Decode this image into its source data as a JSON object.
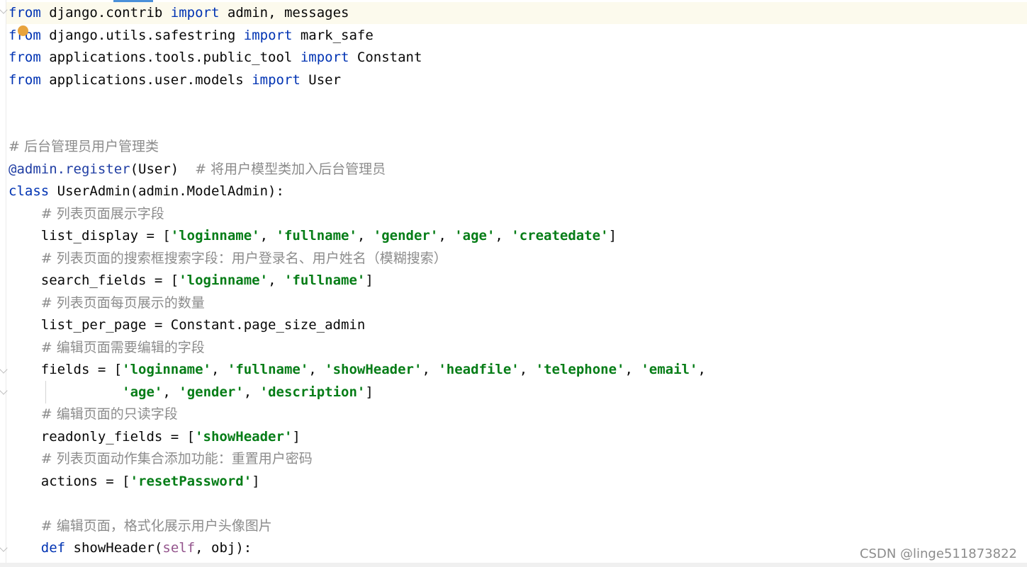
{
  "lines": [
    [
      {
        "t": "from",
        "c": "kw"
      },
      {
        "t": " django.contrib "
      },
      {
        "t": "import",
        "c": "kw"
      },
      {
        "t": " admin, messages"
      }
    ],
    [
      {
        "t": "from",
        "c": "kw"
      },
      {
        "t": " django.utils.safestring "
      },
      {
        "t": "import",
        "c": "kw"
      },
      {
        "t": " mark_safe"
      }
    ],
    [
      {
        "t": "from",
        "c": "kw"
      },
      {
        "t": " applications.tools.public_tool "
      },
      {
        "t": "import",
        "c": "kw"
      },
      {
        "t": " Constant"
      }
    ],
    [
      {
        "t": "from",
        "c": "kw"
      },
      {
        "t": " applications.user.models "
      },
      {
        "t": "import",
        "c": "kw"
      },
      {
        "t": " User"
      }
    ],
    [],
    [],
    [
      {
        "t": "# 后台管理员用户管理类",
        "c": "cmt"
      }
    ],
    [
      {
        "t": "@admin.register",
        "c": "deco"
      },
      {
        "t": "(User)  "
      },
      {
        "t": "# 将用户模型类加入后台管理员",
        "c": "cmt"
      }
    ],
    [
      {
        "t": "class",
        "c": "kw"
      },
      {
        "t": " UserAdmin(admin.ModelAdmin):"
      }
    ],
    [
      {
        "t": "    "
      },
      {
        "t": "# 列表页面展示字段",
        "c": "cmt"
      }
    ],
    [
      {
        "t": "    list_display = ["
      },
      {
        "t": "'loginname'",
        "c": "str"
      },
      {
        "t": ", "
      },
      {
        "t": "'fullname'",
        "c": "str"
      },
      {
        "t": ", "
      },
      {
        "t": "'gender'",
        "c": "str"
      },
      {
        "t": ", "
      },
      {
        "t": "'age'",
        "c": "str"
      },
      {
        "t": ", "
      },
      {
        "t": "'createdate'",
        "c": "str"
      },
      {
        "t": "]"
      }
    ],
    [
      {
        "t": "    "
      },
      {
        "t": "# 列表页面的搜索框搜索字段：用户登录名、用户姓名（模糊搜索）",
        "c": "cmt"
      }
    ],
    [
      {
        "t": "    search_fields = ["
      },
      {
        "t": "'loginname'",
        "c": "str"
      },
      {
        "t": ", "
      },
      {
        "t": "'fullname'",
        "c": "str"
      },
      {
        "t": "]"
      }
    ],
    [
      {
        "t": "    "
      },
      {
        "t": "# 列表页面每页展示的数量",
        "c": "cmt"
      }
    ],
    [
      {
        "t": "    list_per_page = Constant.page_size_admin"
      }
    ],
    [
      {
        "t": "    "
      },
      {
        "t": "# 编辑页面需要编辑的字段",
        "c": "cmt"
      }
    ],
    [
      {
        "t": "    fields = ["
      },
      {
        "t": "'loginname'",
        "c": "str"
      },
      {
        "t": ", "
      },
      {
        "t": "'fullname'",
        "c": "str"
      },
      {
        "t": ", "
      },
      {
        "t": "'showHeader'",
        "c": "str"
      },
      {
        "t": ", "
      },
      {
        "t": "'headfile'",
        "c": "str"
      },
      {
        "t": ", "
      },
      {
        "t": "'telephone'",
        "c": "str"
      },
      {
        "t": ", "
      },
      {
        "t": "'email'",
        "c": "str"
      },
      {
        "t": ","
      }
    ],
    [
      {
        "t": "              "
      },
      {
        "t": "'age'",
        "c": "str"
      },
      {
        "t": ", "
      },
      {
        "t": "'gender'",
        "c": "str"
      },
      {
        "t": ", "
      },
      {
        "t": "'description'",
        "c": "str"
      },
      {
        "t": "]"
      }
    ],
    [
      {
        "t": "    "
      },
      {
        "t": "# 编辑页面的只读字段",
        "c": "cmt"
      }
    ],
    [
      {
        "t": "    readonly_fields = ["
      },
      {
        "t": "'showHeader'",
        "c": "str"
      },
      {
        "t": "]"
      }
    ],
    [
      {
        "t": "    "
      },
      {
        "t": "# 列表页面动作集合添加功能：重置用户密码",
        "c": "cmt"
      }
    ],
    [
      {
        "t": "    actions = ["
      },
      {
        "t": "'resetPassword'",
        "c": "str"
      },
      {
        "t": "]"
      }
    ],
    [],
    [
      {
        "t": "    "
      },
      {
        "t": "# 编辑页面，格式化展示用户头像图片",
        "c": "cmt"
      }
    ],
    [
      {
        "t": "    "
      },
      {
        "t": "def",
        "c": "kw"
      },
      {
        "t": " showHeader("
      },
      {
        "t": "self",
        "c": "self"
      },
      {
        "t": ", obj):"
      }
    ]
  ],
  "watermark": "CSDN @linge511873822",
  "icons": {
    "gutter_marker": "bulb-icon",
    "fold": "fold-arrow-icon"
  },
  "colors": {
    "keyword": "#0033b3",
    "string": "#067d17",
    "comment": "#8c8c8c",
    "decorator": "#1f3da3",
    "self": "#94558d"
  }
}
